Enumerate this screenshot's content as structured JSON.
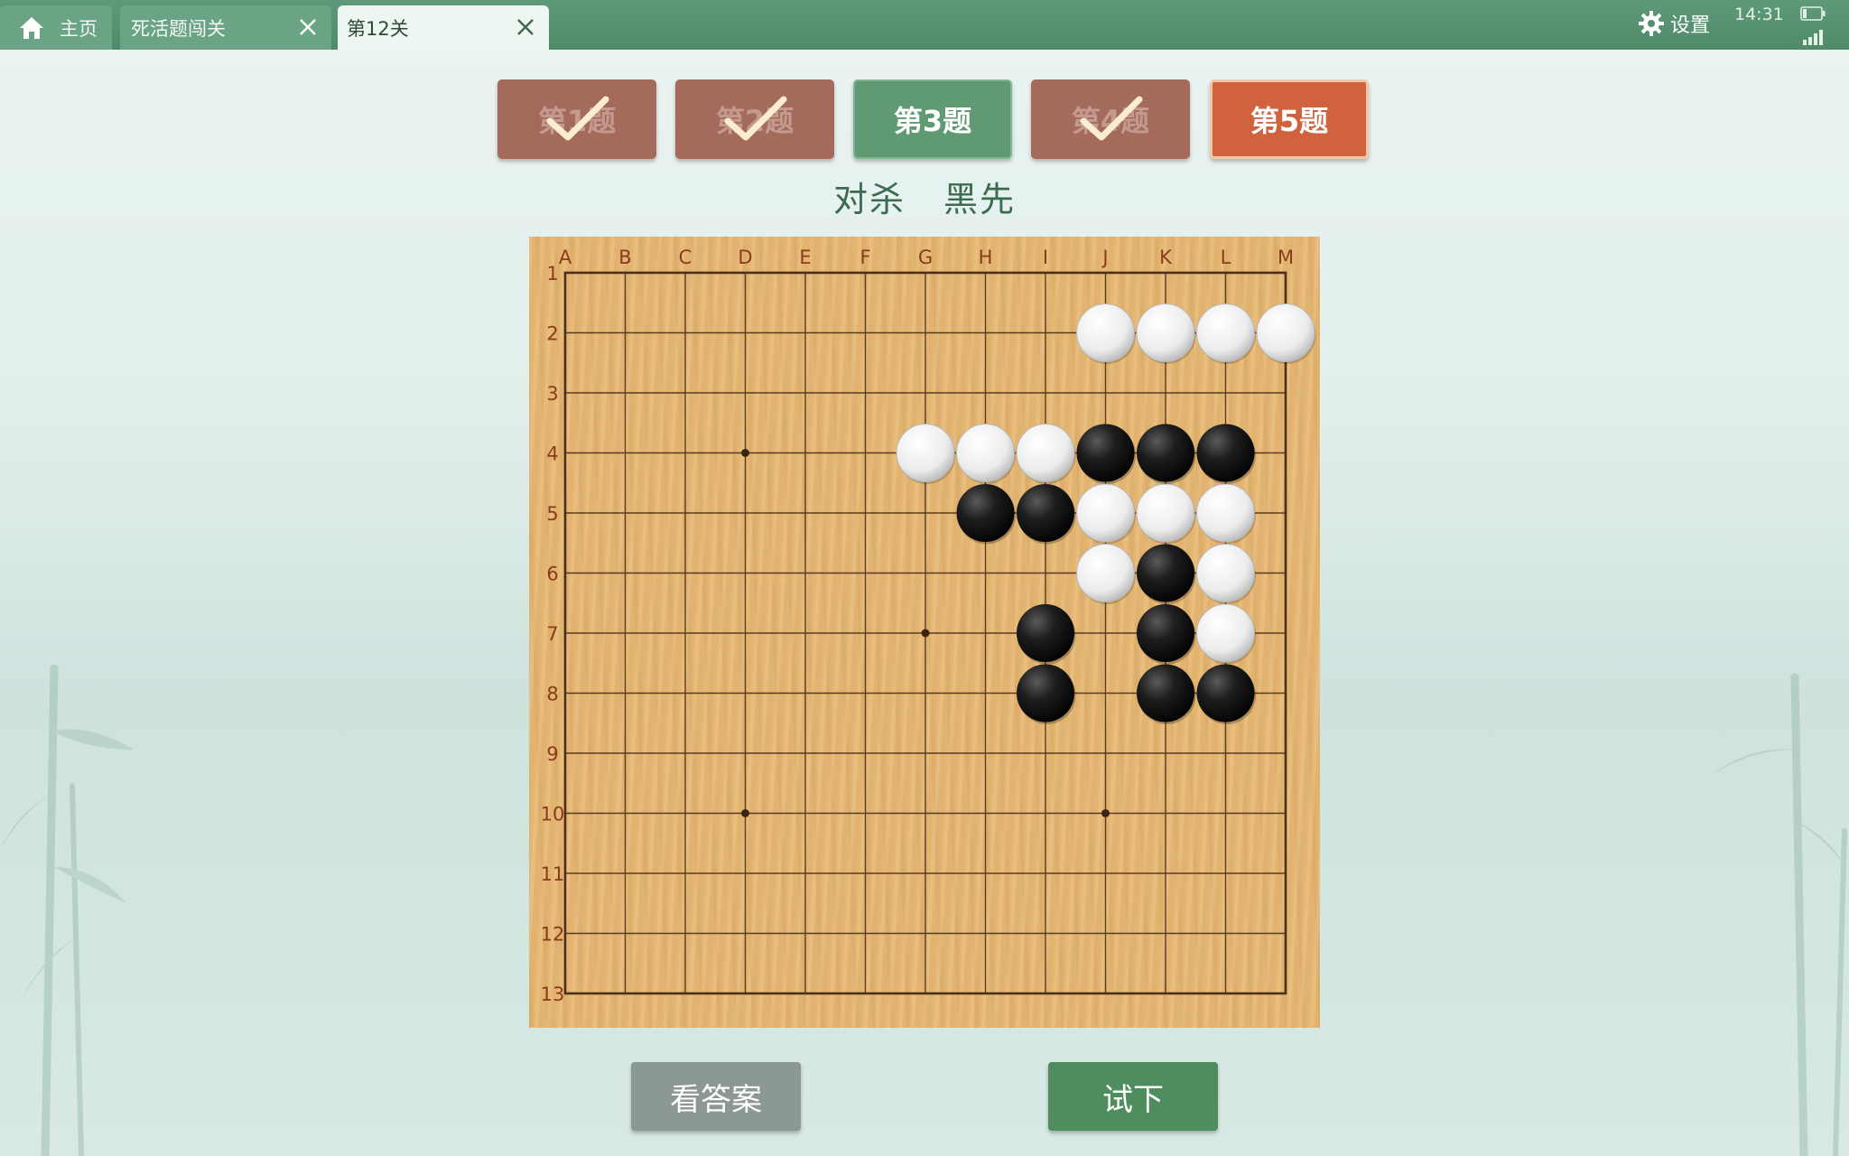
{
  "tabs": {
    "home_label": "主页",
    "level_label": "死活题闯关",
    "current_label": "第12关"
  },
  "status": {
    "settings_label": "设置",
    "time": "14:31"
  },
  "problems": [
    {
      "label": "第1题",
      "state": "done"
    },
    {
      "label": "第2题",
      "state": "done"
    },
    {
      "label": "第3题",
      "state": "current"
    },
    {
      "label": "第4题",
      "state": "done"
    },
    {
      "label": "第5题",
      "state": "next"
    }
  ],
  "subtitle": "对杀 黑先",
  "board": {
    "size": 13,
    "columns": [
      "A",
      "B",
      "C",
      "D",
      "E",
      "F",
      "G",
      "H",
      "I",
      "J",
      "K",
      "L",
      "M"
    ],
    "rows": [
      "1",
      "2",
      "3",
      "4",
      "5",
      "6",
      "7",
      "8",
      "9",
      "10",
      "11",
      "12",
      "13"
    ],
    "star_points": [
      "D4",
      "G7",
      "D10",
      "J10"
    ],
    "white_stones": [
      "J2",
      "K2",
      "L2",
      "M2",
      "G4",
      "H4",
      "I4",
      "J5",
      "K5",
      "L5",
      "J6",
      "L6",
      "L7"
    ],
    "black_stones": [
      "J4",
      "K4",
      "L4",
      "H5",
      "I5",
      "K6",
      "I7",
      "K7",
      "I8",
      "K8",
      "L8"
    ]
  },
  "buttons": {
    "answer_label": "看答案",
    "try_label": "试下"
  },
  "colors": {
    "topbar": "#548f6e",
    "done_button": "#a46b5d",
    "current_button": "#5f9a72",
    "next_button": "#d0623e",
    "board_wood": "#e6b873",
    "subtitle": "#3d6b4f"
  }
}
